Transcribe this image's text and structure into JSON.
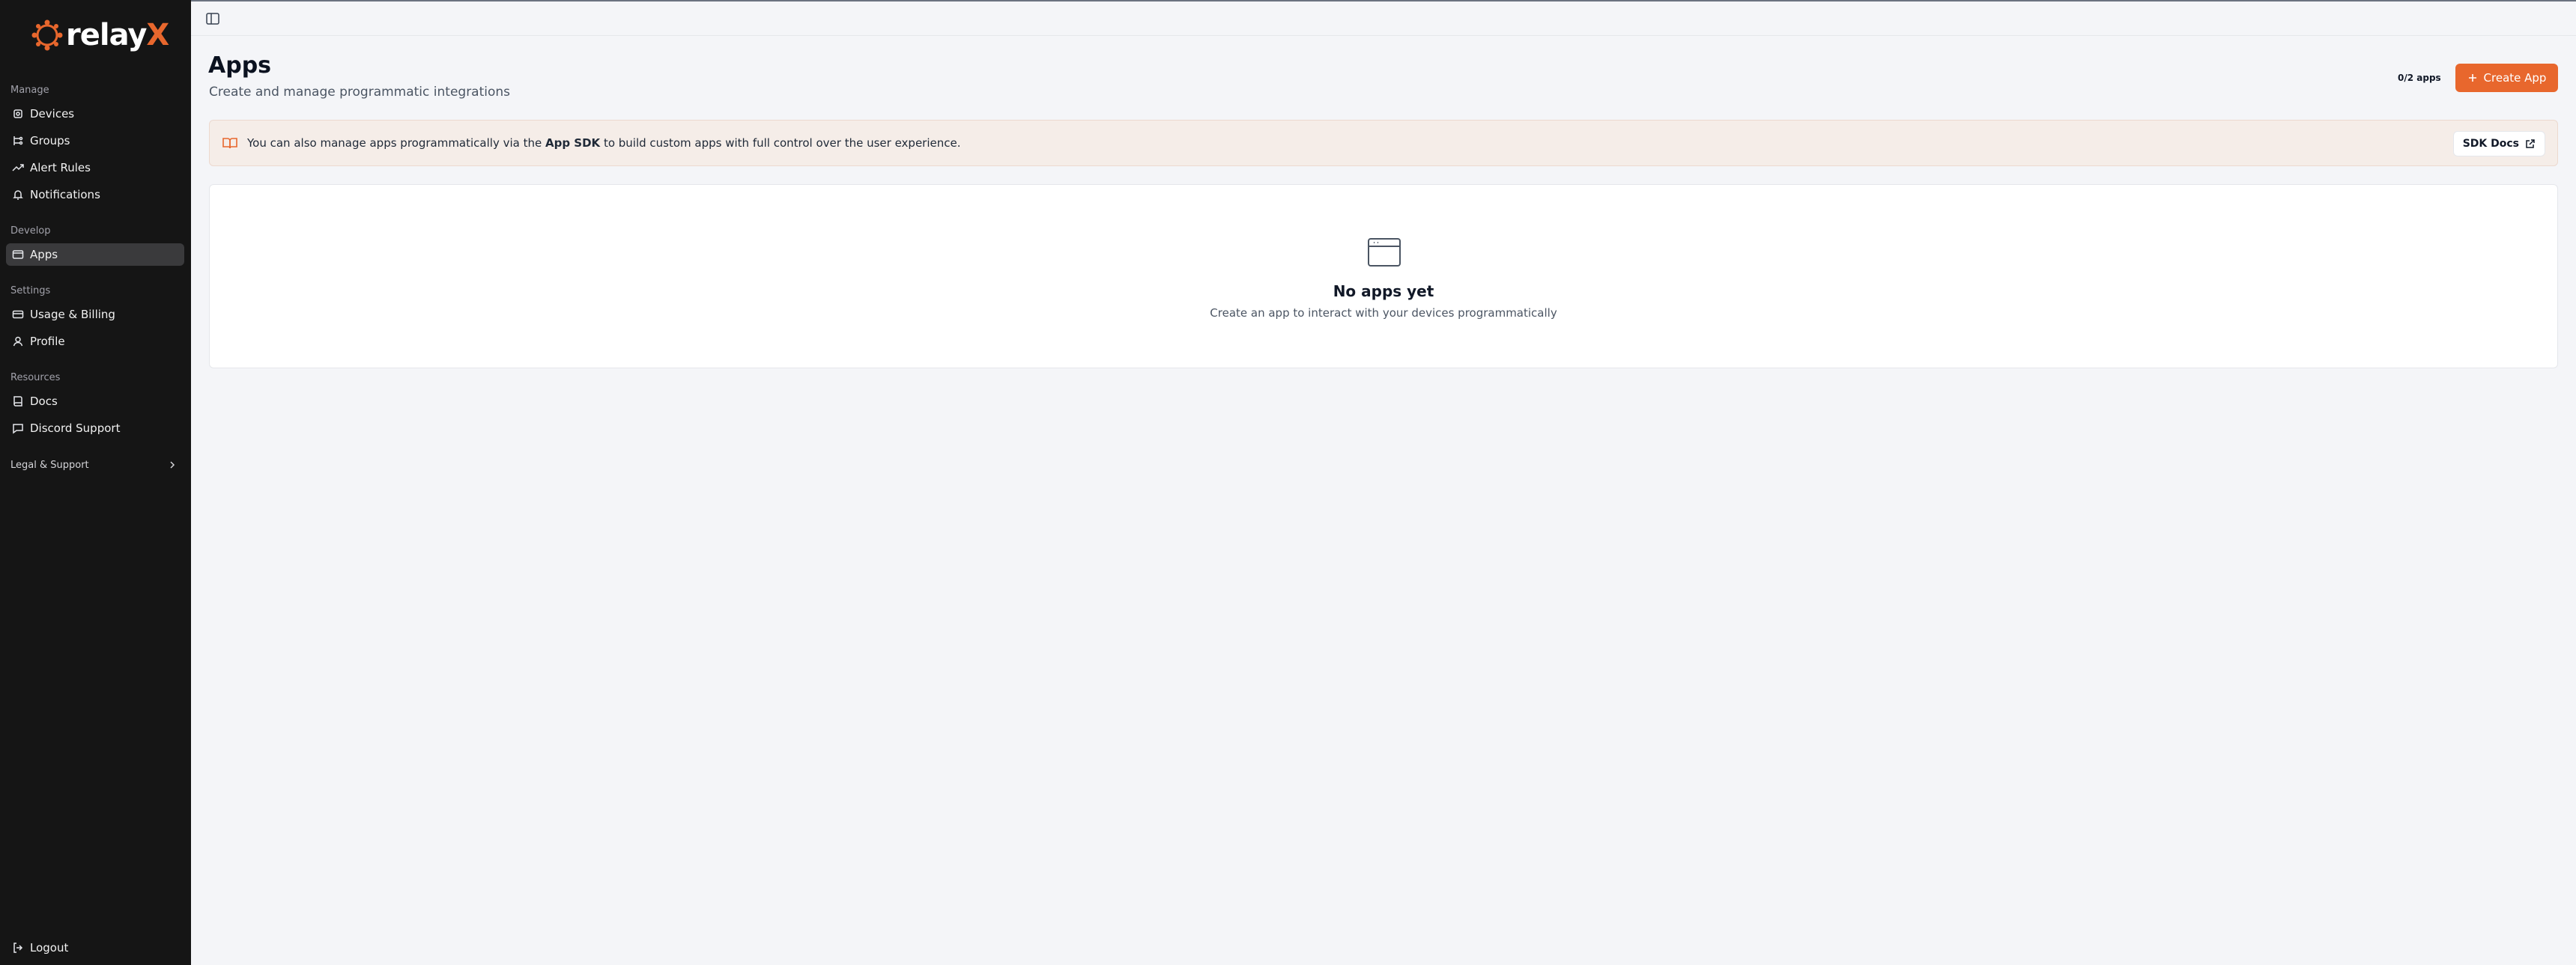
{
  "brand": {
    "name_main": "relay",
    "name_accent": "X",
    "accent_color": "#e8672d"
  },
  "sidebar": {
    "sections": {
      "manage": "Manage",
      "develop": "Develop",
      "settings": "Settings",
      "resources": "Resources"
    },
    "items": {
      "devices": "Devices",
      "groups": "Groups",
      "alert_rules": "Alert Rules",
      "notifications": "Notifications",
      "apps": "Apps",
      "usage_billing": "Usage & Billing",
      "profile": "Profile",
      "docs": "Docs",
      "discord_support": "Discord Support"
    },
    "legal": "Legal & Support",
    "logout": "Logout",
    "active": "apps"
  },
  "header": {
    "title": "Apps",
    "subtitle": "Create and manage programmatic integrations",
    "app_count": "0/2 apps",
    "create_label": "Create App"
  },
  "banner": {
    "text_before": "You can also manage apps programmatically via the ",
    "text_bold": "App SDK",
    "text_after": " to build custom apps with full control over the user experience.",
    "sdk_docs_label": "SDK Docs"
  },
  "empty_state": {
    "title": "No apps yet",
    "description": "Create an app to interact with your devices programmatically"
  }
}
